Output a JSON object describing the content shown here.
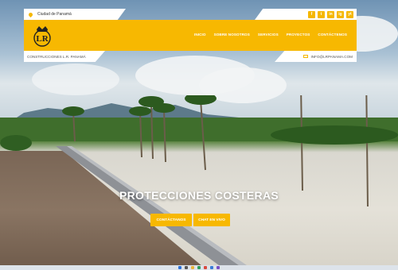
{
  "topbar": {
    "location": "Ciudad de Panamá"
  },
  "social_icons": [
    "f",
    "t",
    "in",
    "ig",
    "yt"
  ],
  "nav": {
    "items": [
      "INICIO",
      "SOBRE NOSOTROS",
      "SERVICIOS",
      "PROYECTOS",
      "CONTÁCTENOS"
    ]
  },
  "subbar": {
    "company": "CONSTRUCCIONES L.R. PANAMÁ",
    "email": "INFO@LRPANAMA.COM"
  },
  "hero": {
    "title": "PROTECCIONES COSTERAS",
    "button_contact": "CONTÁCTANOS",
    "button_chat": "CHAT EN VIVO"
  },
  "colors": {
    "accent": "#f7b801",
    "white": "#ffffff"
  }
}
